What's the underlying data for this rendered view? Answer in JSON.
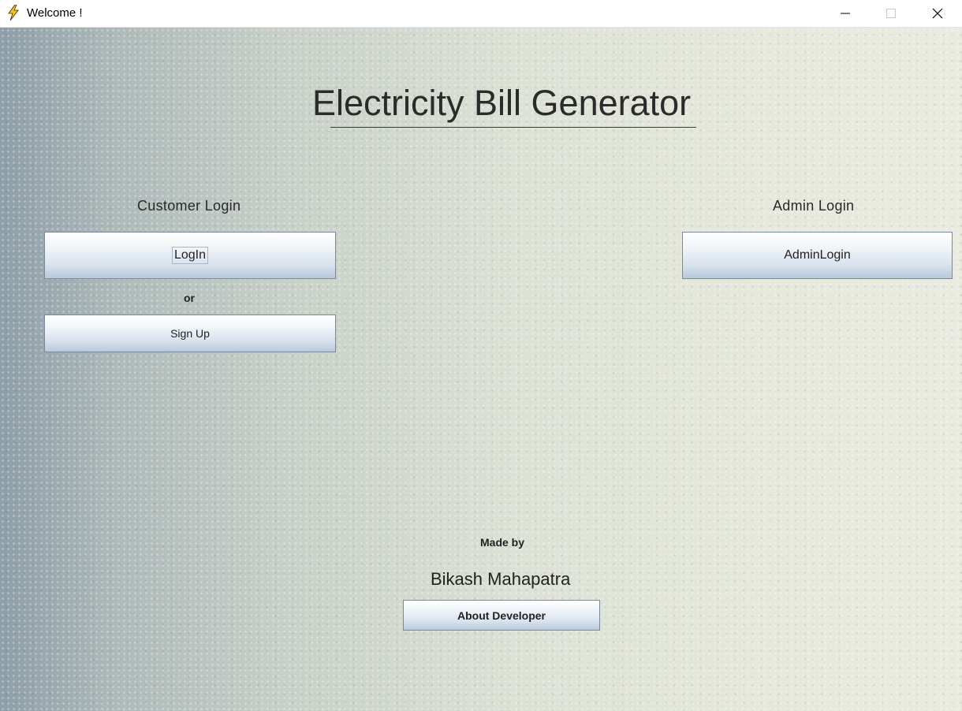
{
  "window": {
    "title": "Welcome !",
    "icon": "lightning-bolt-icon",
    "controls": {
      "minimize_icon": "minimize-icon",
      "maximize_icon": "maximize-icon",
      "close_icon": "close-icon"
    }
  },
  "main": {
    "heading": "Electricity Bill Generator",
    "customer": {
      "label": "Customer Login",
      "login_button": "LogIn",
      "separator": "or",
      "signup_button": "Sign Up"
    },
    "admin": {
      "label": "Admin Login",
      "login_button": "AdminLogin"
    },
    "footer": {
      "made_by": "Made by",
      "developer_name": "Bikash Mahapatra",
      "about_button": "About Developer"
    }
  },
  "colors": {
    "button_border": "#7a8a9c",
    "text": "#222222",
    "background_left": "#8e9fa8",
    "background_right": "#e9ebe0"
  }
}
